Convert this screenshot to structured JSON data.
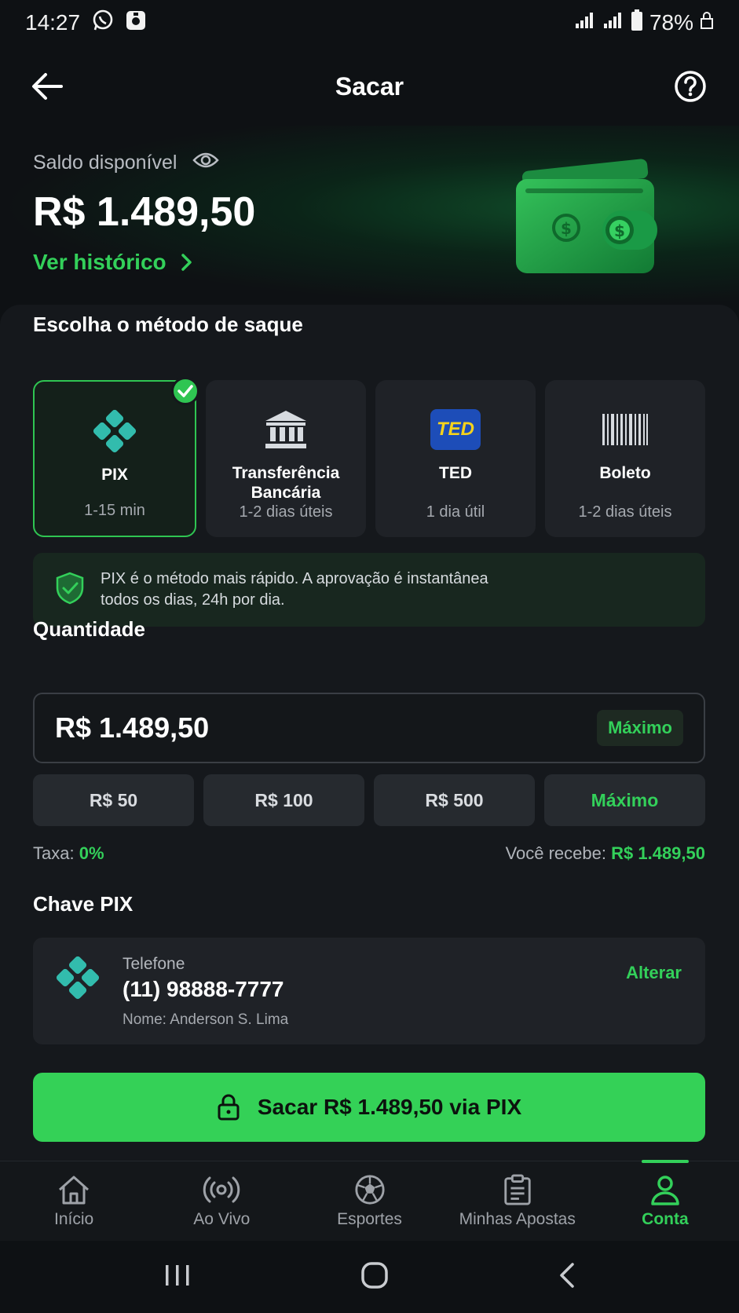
{
  "status_bar": {
    "time": "14:27",
    "battery": "78%"
  },
  "header": {
    "title": "Sacar"
  },
  "balance": {
    "label": "Saldo disponível",
    "value": "R$ 1.489,50",
    "history_link": "Ver histórico"
  },
  "methods_section": {
    "title": "Escolha o método de saque",
    "methods": [
      {
        "name": "PIX",
        "time": "1-15 min",
        "icon": "pix-icon",
        "selected": true
      },
      {
        "name": "Transferência Bancária",
        "time": "1-2 dias úteis",
        "icon": "bank-icon",
        "selected": false
      },
      {
        "name": "TED",
        "time": "1 dia útil",
        "icon": "ted-icon",
        "badge": "TED",
        "selected": false
      },
      {
        "name": "Boleto",
        "time": "1-2 dias úteis",
        "icon": "barcode-icon",
        "selected": false
      }
    ],
    "info": "PIX é o método mais rápido. A aprovação é instantânea todos os dias, 24h por dia."
  },
  "amount": {
    "title": "Quantidade",
    "value": "R$ 1.489,50",
    "max_label": "Máximo",
    "quick": [
      "R$ 50",
      "R$ 100",
      "R$ 500",
      "Máximo"
    ],
    "fee_label": "Taxa:",
    "fee_value": "0%",
    "receive_label": "Você recebe:",
    "receive_value": "R$ 1.489,50"
  },
  "pix_key": {
    "title": "Chave PIX",
    "type": "Telefone",
    "number": "(11) 98888-7777",
    "owner": "Nome: Anderson S. Lima",
    "change": "Alterar"
  },
  "cta": {
    "label": "Sacar R$ 1.489,50 via PIX"
  },
  "bottom_nav": [
    {
      "label": "Início",
      "icon": "home-icon"
    },
    {
      "label": "Ao Vivo",
      "icon": "live-icon"
    },
    {
      "label": "Esportes",
      "icon": "soccer-ball-icon"
    },
    {
      "label": "Minhas Apostas",
      "icon": "clipboard-icon"
    },
    {
      "label": "Conta",
      "icon": "user-icon",
      "active": true
    }
  ],
  "colors": {
    "accent": "#33d05a",
    "background": "#0e1114",
    "card": "#1f2227",
    "pix": "#32bcad"
  }
}
